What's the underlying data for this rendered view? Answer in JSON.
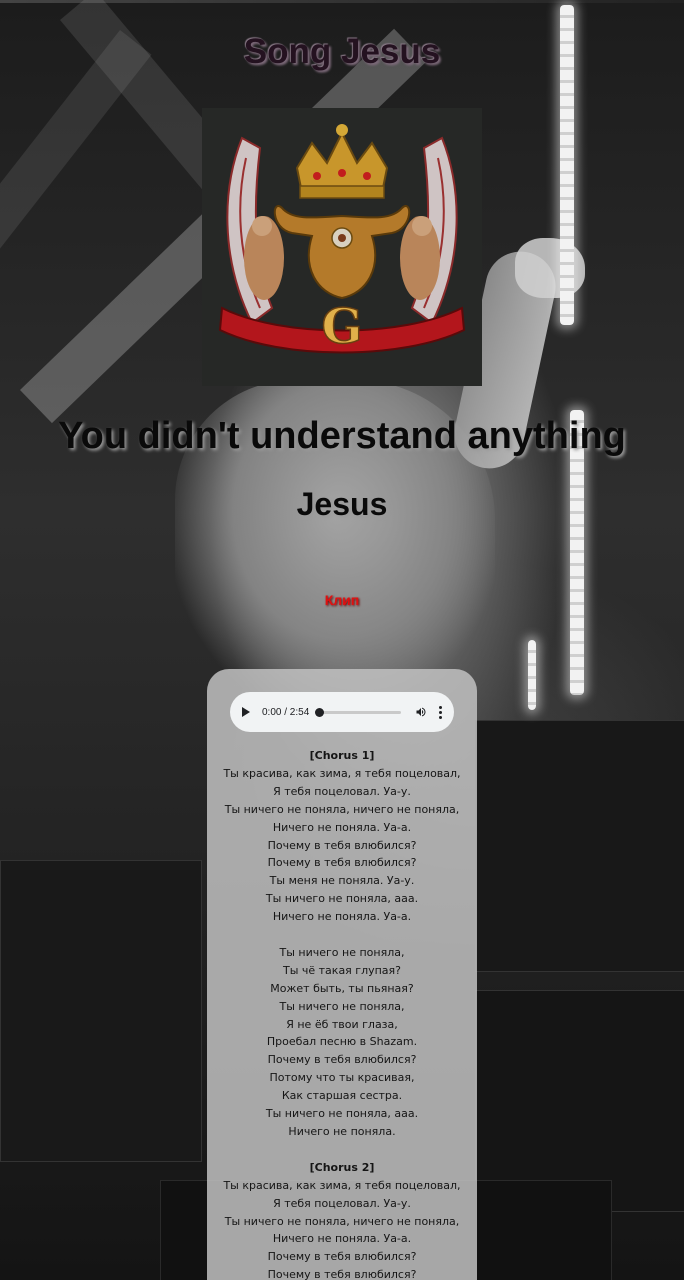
{
  "page": {
    "title": "Song Jesus"
  },
  "song": {
    "title": "You didn't understand anything",
    "artist": "Jesus",
    "clip_link": "Клип"
  },
  "player": {
    "time": "0:00 / 2:54",
    "progress": 0
  },
  "lyrics": {
    "blocks": [
      {
        "heading": "[Chorus 1]",
        "lines": [
          "Ты красива, как зима, я тебя поцеловал,",
          "Я тебя поцеловал. Уа-у.",
          "Ты ничего не поняла, ничего не поняла,",
          "Ничего не поняла. Уа-а.",
          "Почему в тебя влюбился?",
          "Почему в тебя влюбился?",
          "Ты меня не поняла. Уа-у.",
          "Ты ничего не поняла, ааа.",
          "Ничего не поняла. Уа-а."
        ]
      },
      {
        "heading": "",
        "lines": [
          "Ты ничего не поняла,",
          "Ты чё такая глупая?",
          "Может быть, ты пьяная?",
          "Ты ничего не поняла,",
          "Я не ёб твои глаза,",
          "Проебал песню в Shazam.",
          "Почему в тебя влюбился?",
          "Потому что ты красивая,",
          "Как старшая сестра.",
          "Ты ничего не поняла, ааа.",
          "Ничего не поняла."
        ]
      },
      {
        "heading": "[Chorus 2]",
        "lines": [
          "Ты красива, как зима, я тебя поцеловал,",
          "Я тебя поцеловал. Уа-у.",
          "Ты ничего не поняла, ничего не поняла,",
          "Ничего не поняла. Уа-а.",
          "Почему в тебя влюбился?",
          "Почему в тебя влюбился?"
        ]
      }
    ]
  },
  "colors": {
    "clip_link": "#e01010",
    "card": "#c0c0c0",
    "player_bg": "#f1f3f4"
  }
}
